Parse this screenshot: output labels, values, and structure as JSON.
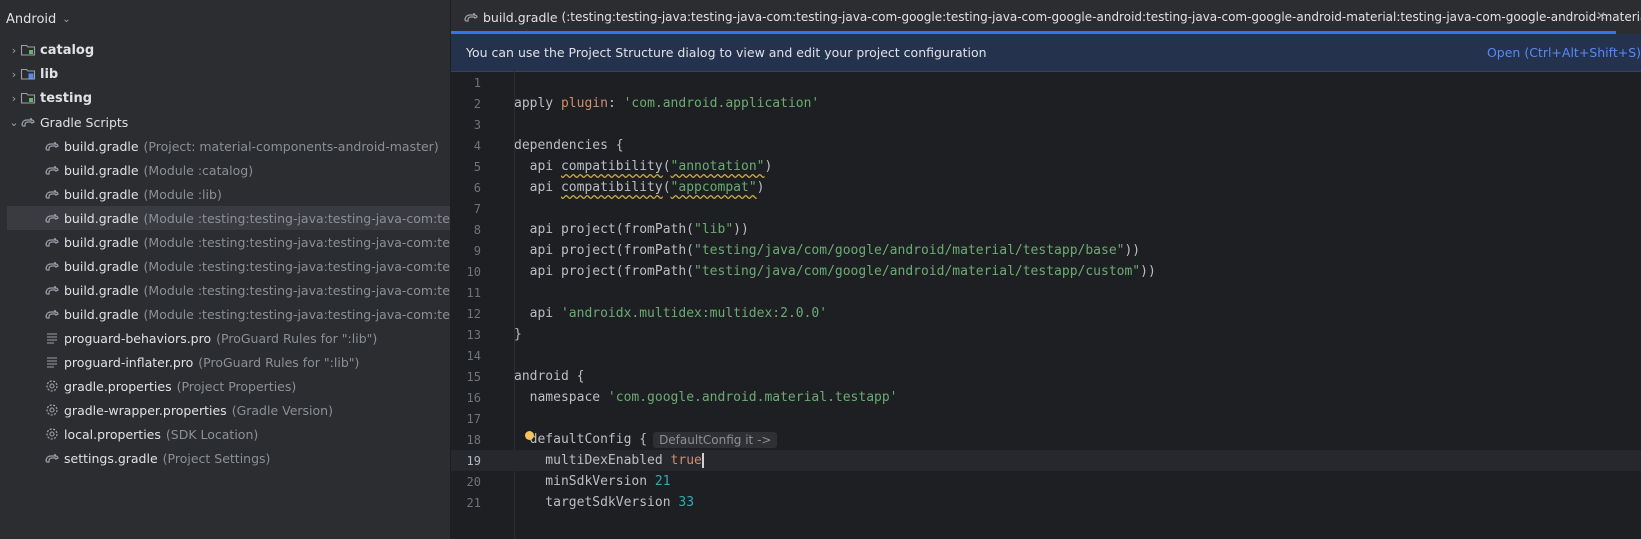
{
  "sidebar": {
    "title": "Android",
    "modules": [
      {
        "label": "catalog",
        "icon": "module-folder-icon"
      },
      {
        "label": "lib",
        "icon": "library-folder-icon"
      },
      {
        "label": "testing",
        "icon": "module-folder-icon"
      }
    ],
    "gradle_scripts": {
      "label": "Gradle Scripts",
      "items": [
        {
          "name": "build.gradle",
          "detail": "(Project: material-components-android-master)",
          "icon": "gradle-icon"
        },
        {
          "name": "build.gradle",
          "detail": "(Module :catalog)",
          "icon": "gradle-icon"
        },
        {
          "name": "build.gradle",
          "detail": "(Module :lib)",
          "icon": "gradle-icon"
        },
        {
          "name": "build.gradle",
          "detail": "(Module :testing:testing-java:testing-java-com:testing-java-",
          "icon": "gradle-icon",
          "selected": true
        },
        {
          "name": "build.gradle",
          "detail": "(Module :testing:testing-java:testing-java-com:testing-java-",
          "icon": "gradle-icon"
        },
        {
          "name": "build.gradle",
          "detail": "(Module :testing:testing-java:testing-java-com:testing-java-",
          "icon": "gradle-icon"
        },
        {
          "name": "build.gradle",
          "detail": "(Module :testing:testing-java:testing-java-com:testing-java-",
          "icon": "gradle-icon"
        },
        {
          "name": "build.gradle",
          "detail": "(Module :testing:testing-java:testing-java-com:testing-java-",
          "icon": "gradle-icon"
        },
        {
          "name": "proguard-behaviors.pro",
          "detail": "(ProGuard Rules for \":lib\")",
          "icon": "text-file-icon"
        },
        {
          "name": "proguard-inflater.pro",
          "detail": "(ProGuard Rules for \":lib\")",
          "icon": "text-file-icon"
        },
        {
          "name": "gradle.properties",
          "detail": "(Project Properties)",
          "icon": "settings-file-icon"
        },
        {
          "name": "gradle-wrapper.properties",
          "detail": "(Gradle Version)",
          "icon": "settings-file-icon"
        },
        {
          "name": "local.properties",
          "detail": "(SDK Location)",
          "icon": "settings-file-icon"
        },
        {
          "name": "settings.gradle",
          "detail": "(Project Settings)",
          "icon": "gradle-icon"
        }
      ]
    }
  },
  "editor": {
    "tab": {
      "name": "build.gradle",
      "detail": "(:testing:testing-java:testing-java-com:testing-java-com-google:testing-java-com-google-android:testing-java-com-google-android-material:testing-java-com-google-android-material-testapp:main)"
    },
    "notice": {
      "text": "You can use the Project Structure dialog to view and edit your project configuration",
      "link": "Open (Ctrl+Alt+Shift+S)"
    },
    "current_line": 19,
    "lines": [
      {
        "n": "1",
        "tokens": []
      },
      {
        "n": "2",
        "tokens": [
          {
            "t": "apply ",
            "c": "plain"
          },
          {
            "t": "plugin",
            "c": "kw"
          },
          {
            "t": ": ",
            "c": "plain"
          },
          {
            "t": "'com.android.application'",
            "c": "str"
          }
        ]
      },
      {
        "n": "3",
        "tokens": []
      },
      {
        "n": "4",
        "tokens": [
          {
            "t": "dependencies {",
            "c": "plain"
          }
        ]
      },
      {
        "n": "5",
        "tokens": [
          {
            "t": "  api ",
            "c": "plain"
          },
          {
            "t": "compatibility",
            "c": "plain sq"
          },
          {
            "t": "(",
            "c": "plain"
          },
          {
            "t": "\"annotation\"",
            "c": "str sq"
          },
          {
            "t": ")",
            "c": "plain"
          }
        ]
      },
      {
        "n": "6",
        "tokens": [
          {
            "t": "  api ",
            "c": "plain"
          },
          {
            "t": "compatibility",
            "c": "plain sq"
          },
          {
            "t": "(",
            "c": "plain"
          },
          {
            "t": "\"appcompat\"",
            "c": "str sq"
          },
          {
            "t": ")",
            "c": "plain"
          }
        ]
      },
      {
        "n": "7",
        "tokens": []
      },
      {
        "n": "8",
        "tokens": [
          {
            "t": "  api project(fromPath(",
            "c": "plain"
          },
          {
            "t": "\"lib\"",
            "c": "str"
          },
          {
            "t": "))",
            "c": "plain"
          }
        ]
      },
      {
        "n": "9",
        "tokens": [
          {
            "t": "  api project(fromPath(",
            "c": "plain"
          },
          {
            "t": "\"testing/java/com/google/android/material/testapp/base\"",
            "c": "str"
          },
          {
            "t": "))",
            "c": "plain"
          }
        ]
      },
      {
        "n": "10",
        "tokens": [
          {
            "t": "  api project(fromPath(",
            "c": "plain"
          },
          {
            "t": "\"testing/java/com/google/android/material/testapp/custom\"",
            "c": "str"
          },
          {
            "t": "))",
            "c": "plain"
          }
        ]
      },
      {
        "n": "11",
        "tokens": []
      },
      {
        "n": "12",
        "tokens": [
          {
            "t": "  api ",
            "c": "plain"
          },
          {
            "t": "'androidx.multidex:multidex:2.0.0'",
            "c": "str"
          }
        ]
      },
      {
        "n": "13",
        "tokens": [
          {
            "t": "}",
            "c": "plain"
          }
        ]
      },
      {
        "n": "14",
        "tokens": []
      },
      {
        "n": "15",
        "tokens": [
          {
            "t": "android {",
            "c": "plain"
          }
        ]
      },
      {
        "n": "16",
        "tokens": [
          {
            "t": "  namespace ",
            "c": "plain"
          },
          {
            "t": "'com.google.android.material.testapp'",
            "c": "str"
          }
        ]
      },
      {
        "n": "17",
        "tokens": []
      },
      {
        "n": "18",
        "tokens": [
          {
            "t": "  defaultConfig {",
            "c": "plain"
          }
        ],
        "hint": "DefaultConfig it ->"
      },
      {
        "n": "19",
        "tokens": [
          {
            "t": "    multiDexEnabled ",
            "c": "plain"
          },
          {
            "t": "true",
            "c": "kw"
          }
        ],
        "caret": true
      },
      {
        "n": "20",
        "tokens": [
          {
            "t": "    minSdkVersion ",
            "c": "plain"
          },
          {
            "t": "21",
            "c": "num"
          }
        ]
      },
      {
        "n": "21",
        "tokens": [
          {
            "t": "    targetSdkVersion ",
            "c": "plain"
          },
          {
            "t": "33",
            "c": "num"
          }
        ]
      }
    ]
  }
}
